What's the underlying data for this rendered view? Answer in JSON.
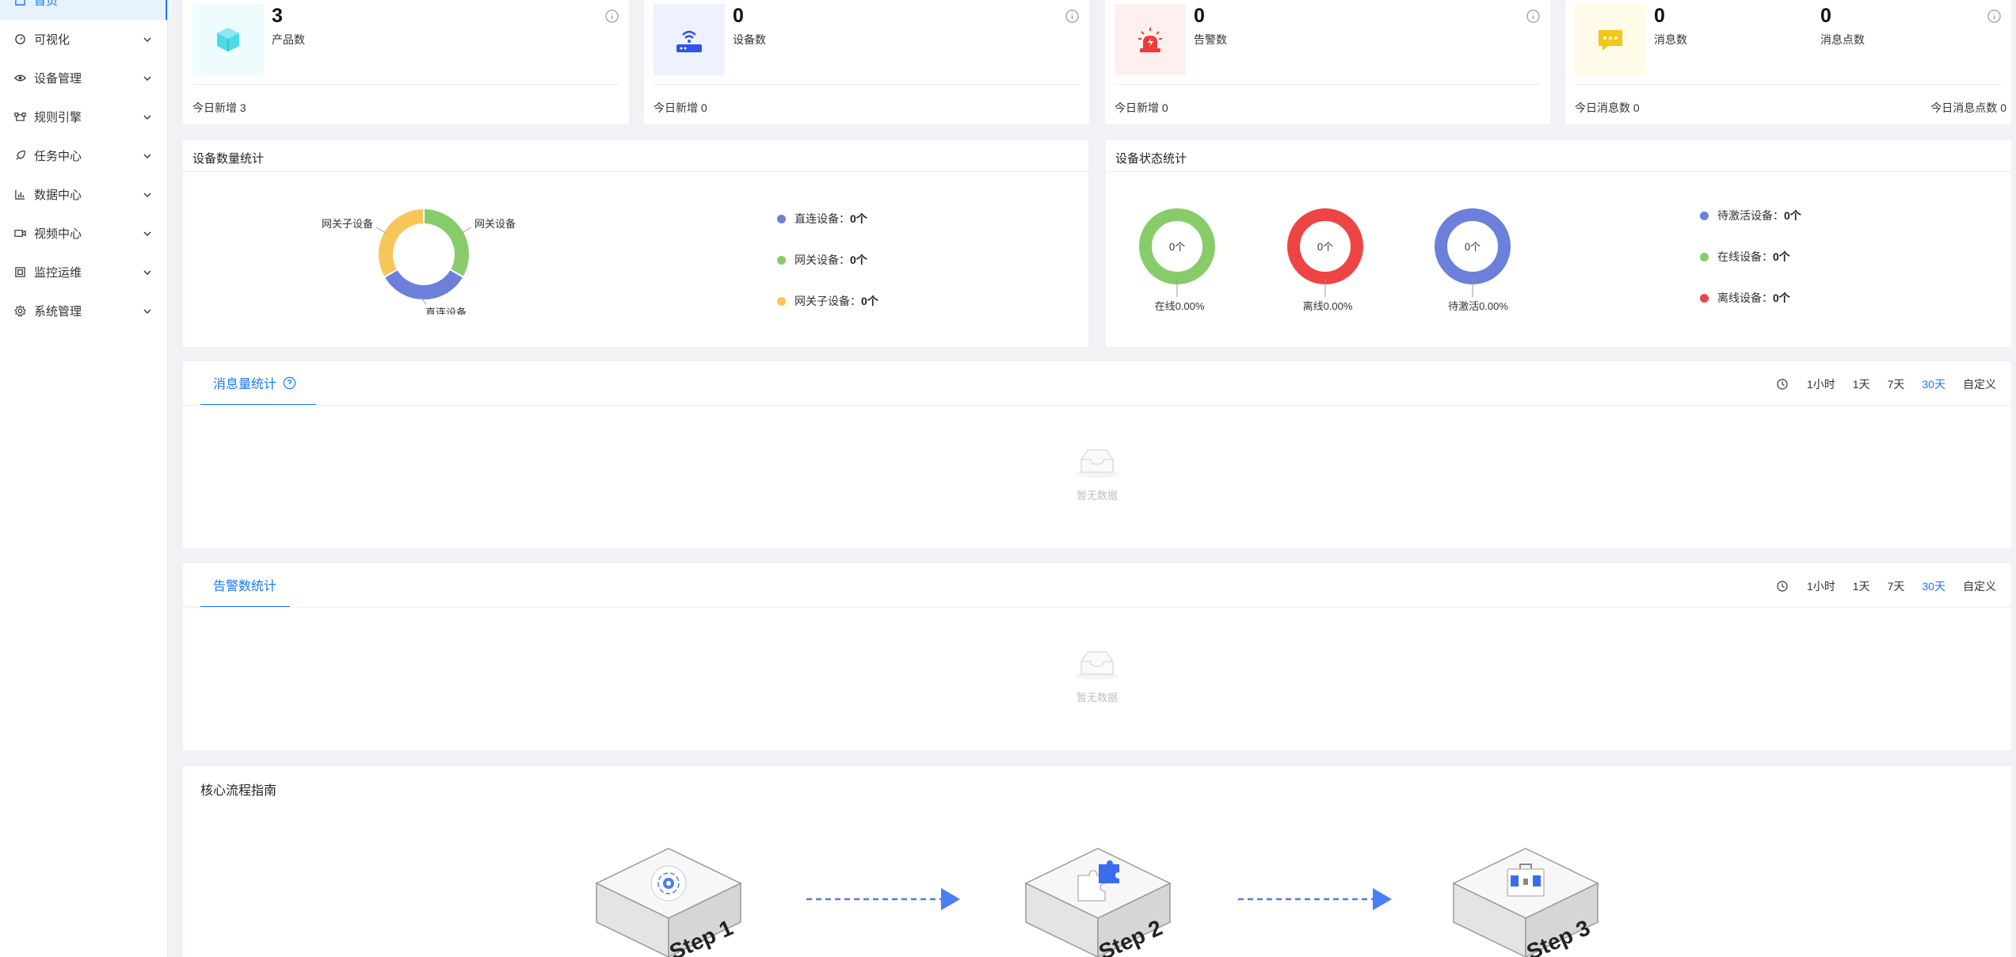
{
  "sidebar": {
    "items": [
      {
        "label": "首页",
        "icon": "home-icon"
      },
      {
        "label": "可视化",
        "icon": "dashboard-icon"
      },
      {
        "label": "设备管理",
        "icon": "eye-icon"
      },
      {
        "label": "规则引擎",
        "icon": "flow-icon"
      },
      {
        "label": "任务中心",
        "icon": "rocket-icon"
      },
      {
        "label": "数据中心",
        "icon": "bar-chart-icon"
      },
      {
        "label": "视频中心",
        "icon": "video-icon"
      },
      {
        "label": "监控运维",
        "icon": "monitor-icon"
      },
      {
        "label": "系统管理",
        "icon": "gear-icon"
      }
    ]
  },
  "stats": {
    "product": {
      "value": "3",
      "label": "产品数",
      "footer": "今日新增 3"
    },
    "device": {
      "value": "0",
      "label": "设备数",
      "footer": "今日新增 0"
    },
    "alarm": {
      "value": "0",
      "label": "告警数",
      "footer": "今日新增 0"
    },
    "message": {
      "value": "0",
      "label": "消息数",
      "value2": "0",
      "label2": "消息点数",
      "footer": "今日消息数 0",
      "footer2": "今日消息点数 0"
    }
  },
  "device_count": {
    "title": "设备数量统计",
    "legend": [
      {
        "label": "直连设备：",
        "value": "0个",
        "color": "#6b7fdb"
      },
      {
        "label": "网关设备：",
        "value": "0个",
        "color": "#88cc6a"
      },
      {
        "label": "网关子设备：",
        "value": "0个",
        "color": "#f7c65a"
      }
    ]
  },
  "device_status": {
    "title": "设备状态统计",
    "rings": [
      {
        "center": "0个",
        "caption": "在线0.00%",
        "color": "#88cc6a"
      },
      {
        "center": "0个",
        "caption": "离线0.00%",
        "color": "#ee4444"
      },
      {
        "center": "0个",
        "caption": "待激活0.00%",
        "color": "#6b7fdb"
      }
    ],
    "legend": [
      {
        "label": "待激活设备：",
        "value": "0个",
        "color": "#6b7fdb"
      },
      {
        "label": "在线设备：",
        "value": "0个",
        "color": "#88cc6a"
      },
      {
        "label": "离线设备：",
        "value": "0个",
        "color": "#ee4444"
      }
    ]
  },
  "chart_data": {
    "type": "pie",
    "categories": [
      "网关设备",
      "直连设备",
      "网关子设备"
    ],
    "values": [
      1,
      1,
      1
    ],
    "colors": [
      "#88cc6a",
      "#6b7fdb",
      "#f7c65a"
    ]
  },
  "ranges": [
    "1小时",
    "1天",
    "7天",
    "30天",
    "自定义"
  ],
  "selected_range": "30天",
  "message_stats": {
    "title": "消息量统计",
    "empty": "暂无数据"
  },
  "alarm_stats": {
    "title": "告警数统计",
    "empty": "暂无数据"
  },
  "guide": {
    "title": "核心流程指南",
    "steps": [
      "Step 1",
      "Step 2",
      "Step 3"
    ]
  }
}
